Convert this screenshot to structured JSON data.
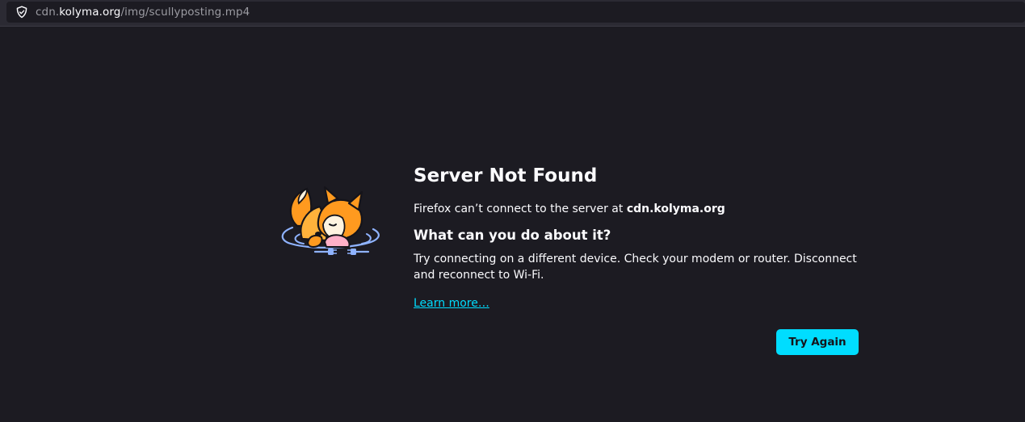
{
  "address_bar": {
    "url_prefix": "cdn.",
    "url_host": "kolyma.org",
    "url_path": "/img/scullyposting.mp4",
    "icon": "shield-icon"
  },
  "error": {
    "illustration": "fox-unplugged-illustration",
    "title": "Server Not Found",
    "description_prefix": "Firefox can’t connect to the server at ",
    "description_host": "cdn.kolyma.org",
    "subtitle": "What can you do about it?",
    "advice": "Try connecting on a different device. Check your modem or router. Disconnect and reconnect to Wi-Fi.",
    "learn_more": "Learn more…",
    "try_again": "Try Again"
  },
  "colors": {
    "background": "#1c1b22",
    "accent": "#00ddff",
    "text": "#fbfbfe"
  }
}
